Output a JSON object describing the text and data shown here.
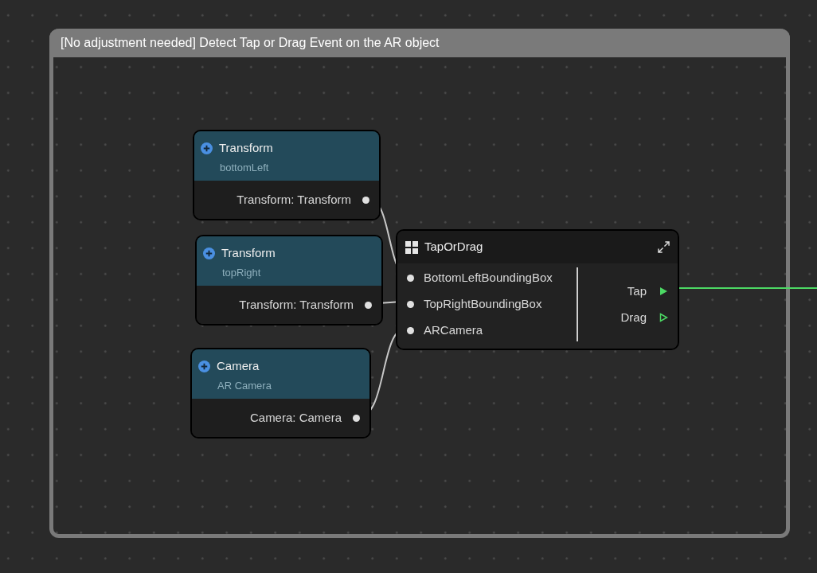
{
  "group": {
    "title": "[No adjustment needed] Detect Tap or Drag Event on the AR object"
  },
  "nodes": [
    {
      "kind": "variable",
      "title": "Transform",
      "subtitle": "bottomLeft",
      "output": "Transform: Transform"
    },
    {
      "kind": "variable",
      "title": "Transform",
      "subtitle": "topRight",
      "output": "Transform: Transform"
    },
    {
      "kind": "variable",
      "title": "Camera",
      "subtitle": "AR Camera",
      "output": "Camera: Camera"
    },
    {
      "kind": "function",
      "title": "TapOrDrag",
      "inputs": [
        "BottomLeftBoundingBox",
        "TopRightBoundingBox",
        "ARCamera"
      ],
      "outputs": [
        {
          "label": "Tap",
          "connected": true
        },
        {
          "label": "Drag",
          "connected": false
        }
      ]
    }
  ]
}
